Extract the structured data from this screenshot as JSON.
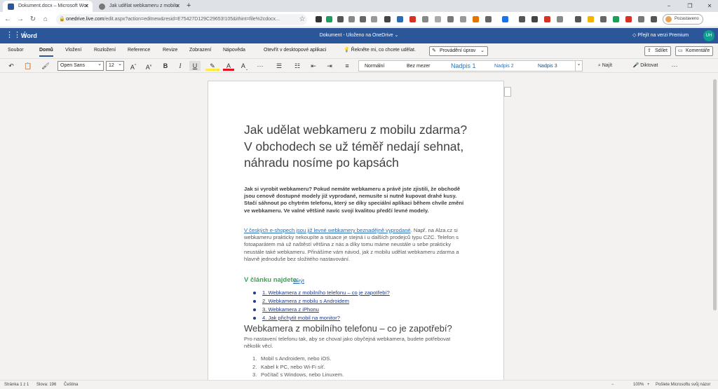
{
  "browser": {
    "tabs": [
      {
        "title": "Dokument.docx – Microsoft Wor",
        "active": true
      },
      {
        "title": "Jak udělat webkameru z mobilu",
        "active": false
      }
    ],
    "new_tab_icon": "+",
    "url_prefix": "onedrive.live.com",
    "url_rest": "/edit.aspx?action=editnew&resid=E75427D129C29653!105&ithint=file%2cdocx...",
    "profile_label": "Pozastaveno",
    "window_controls": [
      "−",
      "❐",
      "✕"
    ]
  },
  "word": {
    "app_name": "Word",
    "doc_title": "Dokument - Uloženo na OneDrive ⌄",
    "premium": "Přejít na verzi Premium",
    "avatar": "UH"
  },
  "menu": {
    "items": [
      "Soubor",
      "Domů",
      "Vložení",
      "Rozložení",
      "Reference",
      "Revize",
      "Zobrazení",
      "Nápověda",
      "Otevřít v desktopové aplikaci",
      "Řekněte mi, co chcete udělat."
    ],
    "editing": "Provádění úprav",
    "share": "Sdílet",
    "comments": "Komentáře"
  },
  "ribbon": {
    "font": "Open Sans",
    "size": "12",
    "styles": [
      "Normální",
      "Bez mezer",
      "Nadpis 1",
      "Nadpis 2",
      "Nadpis 3"
    ],
    "find": "Najít",
    "dictate": "Diktovat"
  },
  "doc": {
    "title": "Jak udělat webkameru z mobilu zdarma? V obchodech se už téměř nedají sehnat, náhradu nosíme po kapsách",
    "lead": "Jak si vyrobit webkameru? Pokud nemáte webkameru a právě jste zjistili, že obchodě jsou cenově dostupné modely již vyprodané, nemusíte si nutně kupovat drahé kusy. Stačí sáhnout po chytrém telefonu, který se díky speciální aplikaci během chvíle změní ve webkameru. Ve valné většině navíc svojí kvalitou předčí levné modely.",
    "body_link": "V českých e-shopech jsou již levné webkamery beznadějně vyprodané",
    "body_rest": ". Např. na Alza.cz si webkameru prakticky nekoupíte a situace je stejná i u dalších prodejců typu CZC. Telefon s fotoaparátem má už naštěstí většina z nás a díky tomu máme neustále u sebe prakticky neustále také webkameru. Přinášíme vám návod, jak z mobilu udělat webkameru zdarma a hlavně jednoduše bez složitého nastavování.",
    "toc_title": "V článku najdete:",
    "toc_hide": "skrýt",
    "toc": [
      "1. Webkamera z mobilního telefonu – co je zapotřebí?",
      "2. Webkamera z mobilu s Androidem",
      "3. Webkamera z iPhonu",
      "4. Jak přichytit mobil na monitor?"
    ],
    "h2": "Webkamera z mobilního telefonu – co je zapotřebí?",
    "p2": "Pro nastavení telefonu tak, aby se choval jako obyčejná webkamera, budete potřebovat několik věcí.",
    "list": [
      {
        "num": "1.",
        "text": "Mobil s Androidem, nebo iOS."
      },
      {
        "num": "2.",
        "text": "Kabel k PC, nebo Wi-Fi síť."
      },
      {
        "num": "3.",
        "text": "Počítač s Windows, nebo Linuxem."
      }
    ]
  },
  "status": {
    "page": "Stránka 1 z 1",
    "words": "Slova: 196",
    "lang": "Čeština",
    "zoom": "100%",
    "feedback": "Pošlete Microsoftu svůj názor"
  }
}
